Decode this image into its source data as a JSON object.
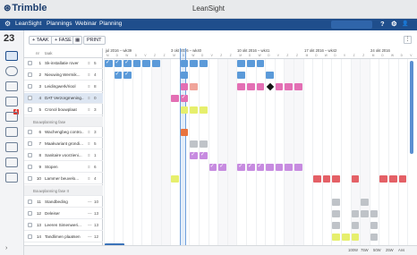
{
  "window": {
    "title": "LeanSight",
    "logo": "Trimble"
  },
  "menubar": {
    "items": [
      "LeanSight",
      "Plannings",
      "Webinar",
      "Planning"
    ],
    "right_icons": [
      "?",
      "⚙",
      "👤"
    ]
  },
  "rail": {
    "week_number": "23",
    "badge": "4"
  },
  "toolbar": {
    "task_label": "+ TAAK",
    "phase_label": "+ FASE",
    "print_label": "PRINT",
    "menu_label": "⋮"
  },
  "table": {
    "headers": {
      "num": "nr",
      "name": "taak"
    },
    "rows": [
      {
        "type": "task",
        "num": "1",
        "name": "Sk-installatie rover",
        "flag": "≡",
        "cnt": "5"
      },
      {
        "type": "task",
        "num": "2",
        "name": "Nieuwing Wermik...",
        "flag": "≡",
        "cnt": "4"
      },
      {
        "type": "task",
        "num": "3",
        "name": "Leidingwerk/riool",
        "flag": "≡",
        "cnt": "8"
      },
      {
        "type": "task",
        "num": "4",
        "name": "DAT Verzorgmening...",
        "flag": "≡",
        "cnt": "0",
        "selected": true
      },
      {
        "type": "task",
        "num": "5",
        "name": "Cronol bouwplaat",
        "flag": "≡",
        "cnt": "3"
      },
      {
        "type": "group",
        "name": "Bouwplanning fase"
      },
      {
        "type": "task",
        "num": "6",
        "name": "Wachengbeg contro...",
        "flag": "≡",
        "cnt": "3"
      },
      {
        "type": "task",
        "num": "7",
        "name": "Maakvariant grondi...",
        "flag": "≡",
        "cnt": "5"
      },
      {
        "type": "task",
        "num": "8",
        "name": "Sanitaire voorzieni...",
        "flag": "≡",
        "cnt": "1"
      },
      {
        "type": "task",
        "num": "9",
        "name": "Stopen",
        "flag": "≡",
        "cnt": "6"
      },
      {
        "type": "task",
        "num": "10",
        "name": "Lammer beuvelo...",
        "flag": "≡",
        "cnt": "4"
      },
      {
        "type": "group",
        "name": "Bouwplanning fase II"
      },
      {
        "type": "task",
        "num": "11",
        "name": "Standbeding",
        "flag": "—",
        "cnt": "10"
      },
      {
        "type": "task",
        "num": "12",
        "name": "Deleiser",
        "flag": "—",
        "cnt": "13"
      },
      {
        "type": "task",
        "num": "13",
        "name": "Leeren Simenweri...",
        "flag": "—",
        "cnt": "13"
      },
      {
        "type": "task",
        "num": "14",
        "name": "Tandlimen plaatsen",
        "flag": "—",
        "cnt": "12"
      }
    ]
  },
  "timeline": {
    "weeks": [
      "jul 2016 – wk39",
      "3 okt 2016 – wk40",
      "10 okt 2016 – wk41",
      "17 okt 2016 – wk42",
      "24 okt 2016"
    ],
    "day_letters": [
      "M",
      "D",
      "W",
      "D",
      "V",
      "Z",
      "Z"
    ],
    "colors": {
      "blue": "#5b9ad9",
      "pink": "#e36fb4",
      "peach": "#f0a49a",
      "yellow": "#e6ef6d",
      "purple": "#c78be0",
      "orange": "#e8733e",
      "grey": "#bfc3c8",
      "red": "#e46066",
      "dark": "#111111"
    }
  },
  "statusbar": {
    "zoom_options": [
      "100W",
      "75W",
      "50W",
      "25W",
      "Ans"
    ]
  }
}
